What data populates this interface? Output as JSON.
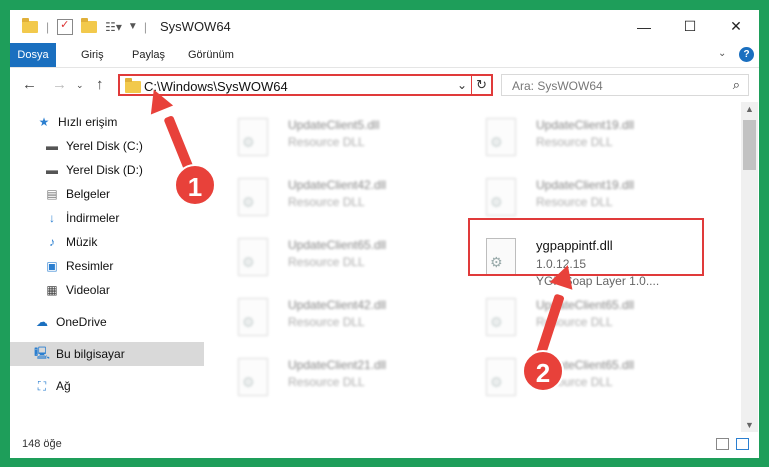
{
  "window": {
    "title": "SysWOW64"
  },
  "ribbon": {
    "tabs": [
      "Dosya",
      "Giriş",
      "Paylaş",
      "Görünüm"
    ]
  },
  "nav": {
    "address": "C:\\Windows\\SysWOW64",
    "search_placeholder": "Ara: SysWOW64"
  },
  "sidebar": {
    "items": [
      {
        "label": "Hızlı erişim",
        "icon": "star-icon",
        "pinned": false
      },
      {
        "label": "Yerel Disk (C:)",
        "icon": "drive-icon",
        "pinned": true
      },
      {
        "label": "Yerel Disk (D:)",
        "icon": "drive-icon",
        "pinned": true
      },
      {
        "label": "Belgeler",
        "icon": "documents-icon",
        "pinned": true
      },
      {
        "label": "İndirmeler",
        "icon": "download-icon",
        "pinned": true
      },
      {
        "label": "Müzik",
        "icon": "music-icon",
        "pinned": true
      },
      {
        "label": "Resimler",
        "icon": "pictures-icon",
        "pinned": true
      },
      {
        "label": "Videolar",
        "icon": "videos-icon",
        "pinned": true
      },
      {
        "label": "OneDrive",
        "icon": "cloud-icon",
        "pinned": false
      },
      {
        "label": "Bu bilgisayar",
        "icon": "computer-icon",
        "pinned": false,
        "selected": true
      },
      {
        "label": "Ağ",
        "icon": "network-icon",
        "pinned": false
      }
    ]
  },
  "files": [
    {
      "name": "UpdateClient5.dll",
      "type": "Resource DLL"
    },
    {
      "name": "UpdateClient19.dll",
      "type": "Resource DLL"
    },
    {
      "name": "UpdateClient42.dll",
      "type": "Resource DLL"
    },
    {
      "name": "UpdateClient19.dll",
      "type": "Resource DLL"
    },
    {
      "name": "UpdateClient65.dll",
      "type": "Resource DLL"
    },
    {
      "name": "ygpappintf.dll",
      "version": "1.0.12.15",
      "type": "YGP Soap Layer 1.0...."
    },
    {
      "name": "UpdateClient42.dll",
      "type": "Resource DLL"
    },
    {
      "name": "UpdateClient65.dll",
      "type": "Resource DLL"
    },
    {
      "name": "UpdateClient21.dll",
      "type": "Resource DLL"
    },
    {
      "name": "UpdateClient65.dll",
      "type": "Resource DLL"
    }
  ],
  "status": {
    "count": "148 öğe"
  },
  "annotations": {
    "badge1": "1",
    "badge2": "2"
  },
  "colors": {
    "accent": "#1a6fbf",
    "highlight": "#e03a3a",
    "background": "#1e9e5a"
  }
}
